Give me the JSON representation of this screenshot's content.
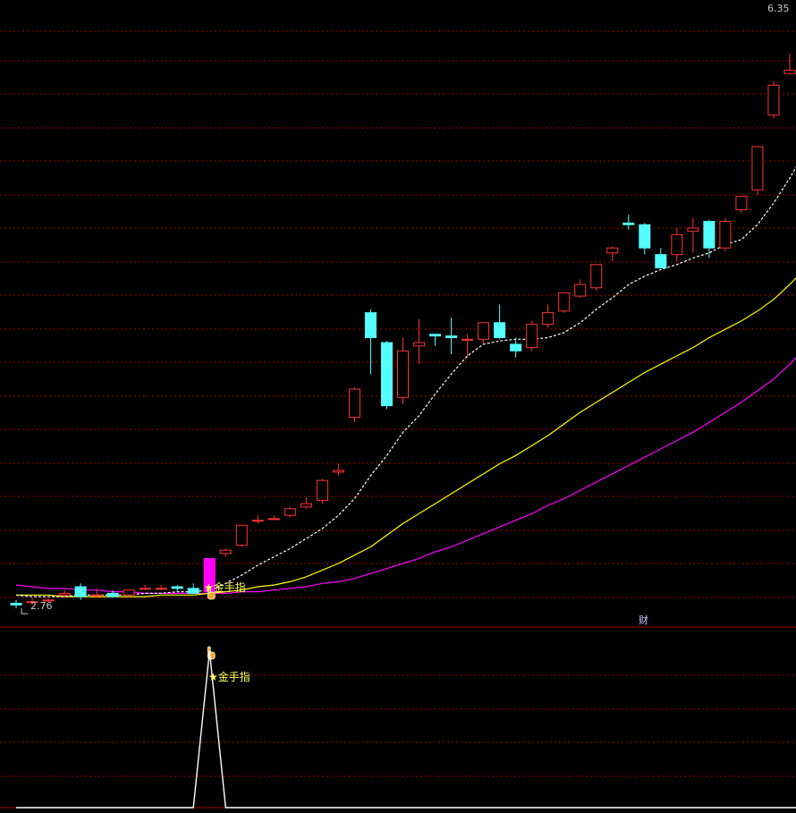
{
  "chart_data": [
    {
      "type": "candlestick",
      "title": "",
      "ylim": [
        2.7,
        6.4
      ],
      "grid": true,
      "price_high_label": "6.35",
      "price_low_label": "2.76",
      "signal_label": "★金手指",
      "cai_label": "财",
      "colors": {
        "up": "#ff3232",
        "down": "#54ffff",
        "signal_bar": "#ff00ff",
        "ma_fast": "#ffffff",
        "ma_mid": "#ffff00",
        "ma_slow": "#ff00ff",
        "grid": "#aa0000",
        "axis": "#aa0000"
      },
      "candles": [
        {
          "o": 2.78,
          "h": 2.8,
          "l": 2.75,
          "c": 2.77
        },
        {
          "o": 2.79,
          "h": 2.81,
          "l": 2.77,
          "c": 2.79
        },
        {
          "o": 2.8,
          "h": 2.81,
          "l": 2.79,
          "c": 2.8
        },
        {
          "o": 2.83,
          "h": 2.86,
          "l": 2.82,
          "c": 2.84
        },
        {
          "o": 2.88,
          "h": 2.9,
          "l": 2.8,
          "c": 2.82
        },
        {
          "o": 2.83,
          "h": 2.87,
          "l": 2.82,
          "c": 2.83
        },
        {
          "o": 2.84,
          "h": 2.86,
          "l": 2.82,
          "c": 2.82
        },
        {
          "o": 2.83,
          "h": 2.86,
          "l": 2.82,
          "c": 2.86
        },
        {
          "o": 2.87,
          "h": 2.89,
          "l": 2.86,
          "c": 2.87
        },
        {
          "o": 2.87,
          "h": 2.89,
          "l": 2.86,
          "c": 2.87
        },
        {
          "o": 2.88,
          "h": 2.89,
          "l": 2.85,
          "c": 2.87
        },
        {
          "o": 2.87,
          "h": 2.9,
          "l": 2.85,
          "c": 2.84
        },
        {
          "o": 2.85,
          "h": 3.05,
          "l": 2.84,
          "c": 3.05,
          "signal": true
        },
        {
          "o": 3.08,
          "h": 3.11,
          "l": 3.06,
          "c": 3.1
        },
        {
          "o": 3.13,
          "h": 3.25,
          "l": 3.12,
          "c": 3.25
        },
        {
          "o": 3.28,
          "h": 3.31,
          "l": 3.26,
          "c": 3.28
        },
        {
          "o": 3.29,
          "h": 3.31,
          "l": 3.28,
          "c": 3.29
        },
        {
          "o": 3.31,
          "h": 3.36,
          "l": 3.3,
          "c": 3.35
        },
        {
          "o": 3.36,
          "h": 3.42,
          "l": 3.35,
          "c": 3.38
        },
        {
          "o": 3.4,
          "h": 3.53,
          "l": 3.38,
          "c": 3.52
        },
        {
          "o": 3.57,
          "h": 3.62,
          "l": 3.55,
          "c": 3.58
        },
        {
          "o": 3.9,
          "h": 4.08,
          "l": 3.87,
          "c": 4.07
        },
        {
          "o": 4.53,
          "h": 4.55,
          "l": 4.16,
          "c": 4.38
        },
        {
          "o": 4.35,
          "h": 4.36,
          "l": 3.95,
          "c": 3.97
        },
        {
          "o": 4.02,
          "h": 4.38,
          "l": 3.98,
          "c": 4.3
        },
        {
          "o": 4.33,
          "h": 4.49,
          "l": 4.22,
          "c": 4.35
        },
        {
          "o": 4.4,
          "h": 4.4,
          "l": 4.33,
          "c": 4.39
        },
        {
          "o": 4.39,
          "h": 4.5,
          "l": 4.28,
          "c": 4.38
        },
        {
          "o": 4.37,
          "h": 4.4,
          "l": 4.26,
          "c": 4.37
        },
        {
          "o": 4.37,
          "h": 4.47,
          "l": 4.34,
          "c": 4.47
        },
        {
          "o": 4.47,
          "h": 4.58,
          "l": 4.37,
          "c": 4.38
        },
        {
          "o": 4.34,
          "h": 4.38,
          "l": 4.26,
          "c": 4.3
        },
        {
          "o": 4.32,
          "h": 4.48,
          "l": 4.3,
          "c": 4.46
        },
        {
          "o": 4.46,
          "h": 4.58,
          "l": 4.44,
          "c": 4.53
        },
        {
          "o": 4.54,
          "h": 4.65,
          "l": 4.53,
          "c": 4.65
        },
        {
          "o": 4.63,
          "h": 4.73,
          "l": 4.62,
          "c": 4.7
        },
        {
          "o": 4.68,
          "h": 4.82,
          "l": 4.66,
          "c": 4.82
        },
        {
          "o": 4.89,
          "h": 4.93,
          "l": 4.84,
          "c": 4.92
        },
        {
          "o": 5.07,
          "h": 5.12,
          "l": 5.03,
          "c": 5.06
        },
        {
          "o": 5.06,
          "h": 5.07,
          "l": 4.88,
          "c": 4.92
        },
        {
          "o": 4.88,
          "h": 4.92,
          "l": 4.82,
          "c": 4.8
        },
        {
          "o": 4.88,
          "h": 5.04,
          "l": 4.84,
          "c": 5.0
        },
        {
          "o": 5.02,
          "h": 5.1,
          "l": 4.89,
          "c": 5.04
        },
        {
          "o": 5.08,
          "h": 5.09,
          "l": 4.86,
          "c": 4.92
        },
        {
          "o": 4.92,
          "h": 5.1,
          "l": 4.9,
          "c": 5.08
        },
        {
          "o": 5.15,
          "h": 5.23,
          "l": 5.13,
          "c": 5.23
        },
        {
          "o": 5.27,
          "h": 5.53,
          "l": 5.24,
          "c": 5.53
        },
        {
          "o": 5.72,
          "h": 5.92,
          "l": 5.7,
          "c": 5.9
        },
        {
          "o": 5.97,
          "h": 6.09,
          "l": 5.97,
          "c": 5.99
        },
        {
          "o": 6.08,
          "h": 6.35,
          "l": 6.08,
          "c": 6.34
        },
        {
          "o": 6.34,
          "h": 6.35,
          "l": 6.08,
          "c": 6.32
        }
      ],
      "ma_fast": [
        2.83,
        2.82,
        2.82,
        2.82,
        2.83,
        2.83,
        2.83,
        2.83,
        2.84,
        2.84,
        2.85,
        2.85,
        2.86,
        2.9,
        2.95,
        3.01,
        3.06,
        3.11,
        3.17,
        3.23,
        3.31,
        3.41,
        3.55,
        3.67,
        3.81,
        3.91,
        4.04,
        4.16,
        4.27,
        4.34,
        4.36,
        4.37,
        4.37,
        4.38,
        4.41,
        4.47,
        4.55,
        4.62,
        4.7,
        4.75,
        4.79,
        4.82,
        4.86,
        4.89,
        4.94,
        4.97,
        5.06,
        5.19,
        5.34,
        5.51,
        5.65
      ],
      "ma_mid": [
        2.83,
        2.83,
        2.83,
        2.82,
        2.82,
        2.82,
        2.82,
        2.82,
        2.82,
        2.83,
        2.83,
        2.83,
        2.84,
        2.85,
        2.86,
        2.88,
        2.89,
        2.91,
        2.94,
        2.98,
        3.02,
        3.07,
        3.12,
        3.19,
        3.26,
        3.32,
        3.38,
        3.44,
        3.5,
        3.56,
        3.62,
        3.67,
        3.73,
        3.79,
        3.86,
        3.93,
        3.99,
        4.05,
        4.11,
        4.17,
        4.22,
        4.27,
        4.32,
        4.38,
        4.43,
        4.48,
        4.54,
        4.61,
        4.7,
        4.8,
        4.92
      ],
      "ma_slow": [
        2.89,
        2.88,
        2.87,
        2.87,
        2.86,
        2.86,
        2.85,
        2.85,
        2.84,
        2.84,
        2.84,
        2.84,
        2.84,
        2.84,
        2.85,
        2.85,
        2.86,
        2.87,
        2.88,
        2.9,
        2.91,
        2.93,
        2.96,
        2.99,
        3.02,
        3.05,
        3.09,
        3.12,
        3.16,
        3.2,
        3.24,
        3.28,
        3.32,
        3.37,
        3.41,
        3.46,
        3.51,
        3.56,
        3.61,
        3.66,
        3.71,
        3.76,
        3.81,
        3.87,
        3.93,
        3.99,
        4.06,
        4.13,
        4.22,
        4.32,
        4.41
      ]
    },
    {
      "type": "line",
      "title": "",
      "ylim": [
        0,
        1
      ],
      "signal_label": "★金手指",
      "values": [
        0,
        0,
        0,
        0,
        0,
        0,
        0,
        0,
        0,
        0,
        0,
        0,
        1,
        0,
        0,
        0,
        0,
        0,
        0,
        0,
        0,
        0,
        0,
        0,
        0,
        0,
        0,
        0,
        0,
        0,
        0,
        0,
        0,
        0,
        0,
        0,
        0,
        0,
        0,
        0,
        0,
        0,
        0,
        0,
        0,
        0,
        0,
        0,
        0,
        0,
        0
      ]
    }
  ]
}
